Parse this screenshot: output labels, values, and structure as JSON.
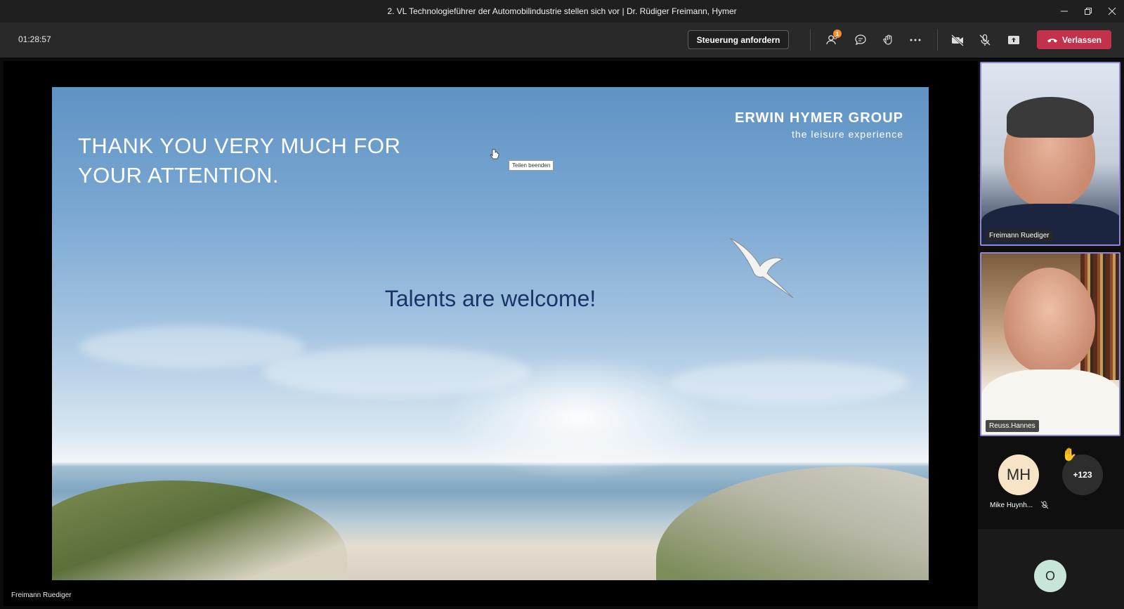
{
  "window": {
    "title": "2. VL Technologieführer der Automobilindustrie stellen sich vor | Dr. Rüdiger Freimann, Hymer"
  },
  "toolbar": {
    "timer": "01:28:57",
    "request_control_label": "Steuerung anfordern",
    "participants_badge": "1",
    "leave_label": "Verlassen",
    "icons": [
      "participants-icon",
      "chat-icon",
      "reactions-icon",
      "more-icon",
      "camera-off-icon",
      "mic-off-icon",
      "share-icon",
      "phone-hangup-icon"
    ]
  },
  "slide": {
    "headline": "THANK YOU VERY MUCH FOR\nYOUR ATTENTION.",
    "brand_name": "ERWIN HYMER GROUP",
    "brand_tagline": "the leisure experience",
    "welcome_text": "Talents are welcome!",
    "tooltip": "Teilen beenden"
  },
  "stage": {
    "presenter_label": "Freimann Ruediger"
  },
  "participants": {
    "tiles": [
      {
        "name": "Freimann Ruediger"
      },
      {
        "name": "Reuss.Hannes"
      }
    ],
    "avatar_mh": {
      "initials": "MH",
      "name": "Mike Huynh..."
    },
    "more_count": "+123",
    "avatar_o": {
      "initials": "O"
    }
  },
  "colors": {
    "accent": "#8f86d8",
    "leave": "#c4314b",
    "badge": "#f28e33",
    "welcome_text": "#1b3468"
  }
}
